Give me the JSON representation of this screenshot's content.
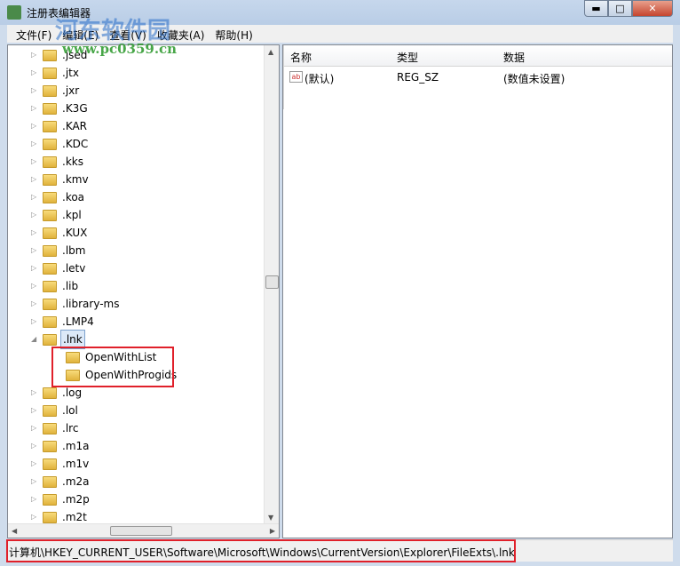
{
  "window": {
    "title": "注册表编辑器",
    "minimize": "▬",
    "maximize": "□",
    "close": "✕"
  },
  "watermark": {
    "name": "河东软件园",
    "url": "www.pc0359.cn"
  },
  "menu": [
    "文件(F)",
    "编辑(E)",
    "查看(V)",
    "收藏夹(A)",
    "帮助(H)"
  ],
  "tree": [
    {
      "label": ".jsed",
      "level": 0
    },
    {
      "label": ".jtx",
      "level": 0
    },
    {
      "label": ".jxr",
      "level": 0
    },
    {
      "label": ".K3G",
      "level": 0
    },
    {
      "label": ".KAR",
      "level": 0
    },
    {
      "label": ".KDC",
      "level": 0
    },
    {
      "label": ".kks",
      "level": 0
    },
    {
      "label": ".kmv",
      "level": 0
    },
    {
      "label": ".koa",
      "level": 0
    },
    {
      "label": ".kpl",
      "level": 0
    },
    {
      "label": ".KUX",
      "level": 0
    },
    {
      "label": ".lbm",
      "level": 0
    },
    {
      "label": ".letv",
      "level": 0
    },
    {
      "label": ".lib",
      "level": 0
    },
    {
      "label": ".library-ms",
      "level": 0
    },
    {
      "label": ".LMP4",
      "level": 0
    },
    {
      "label": ".lnk",
      "level": 0,
      "expanded": true,
      "selected": true
    },
    {
      "label": "OpenWithList",
      "level": 1
    },
    {
      "label": "OpenWithProgids",
      "level": 1
    },
    {
      "label": ".log",
      "level": 0
    },
    {
      "label": ".lol",
      "level": 0
    },
    {
      "label": ".lrc",
      "level": 0
    },
    {
      "label": ".m1a",
      "level": 0
    },
    {
      "label": ".m1v",
      "level": 0
    },
    {
      "label": ".m2a",
      "level": 0
    },
    {
      "label": ".m2p",
      "level": 0
    },
    {
      "label": ".m2t",
      "level": 0
    }
  ],
  "values": {
    "headers": [
      "名称",
      "类型",
      "数据"
    ],
    "rows": [
      {
        "name": "(默认)",
        "type": "REG_SZ",
        "data": "(数值未设置)"
      }
    ]
  },
  "status": "计算机\\HKEY_CURRENT_USER\\Software\\Microsoft\\Windows\\CurrentVersion\\Explorer\\FileExts\\.lnk",
  "colors": {
    "highlight": "#e0202a"
  }
}
